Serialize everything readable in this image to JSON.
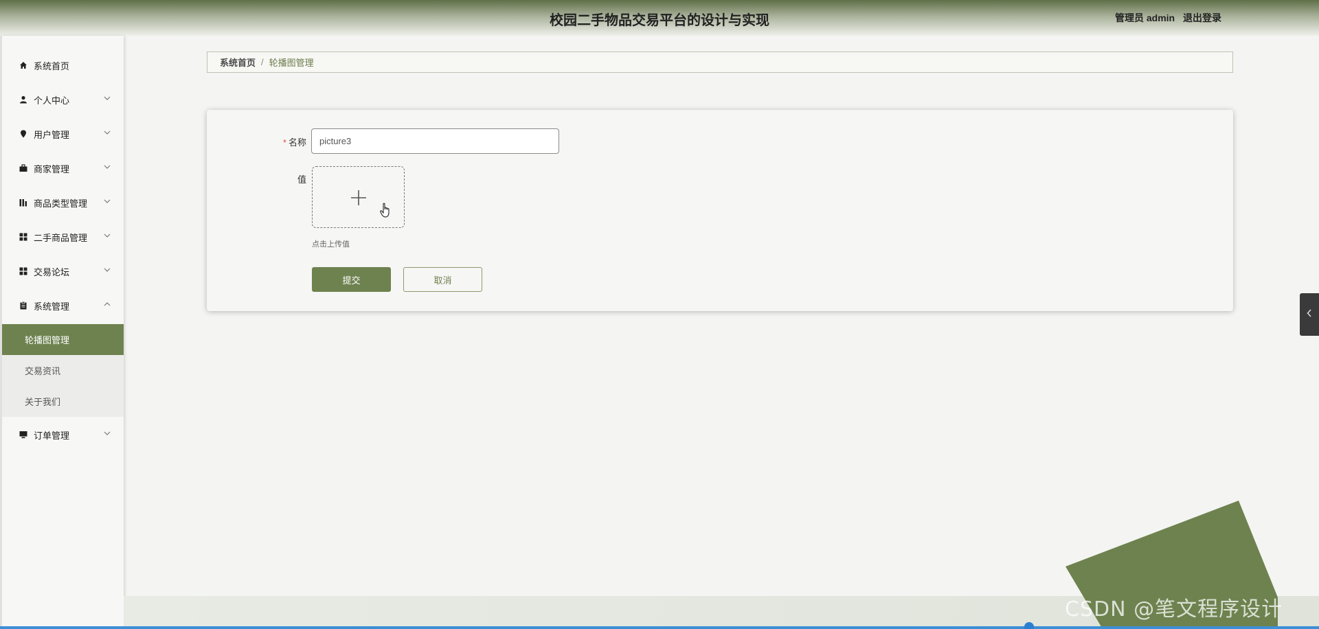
{
  "header": {
    "title": "校园二手物品交易平台的设计与实现",
    "user_label": "管理员 admin",
    "logout_label": "退出登录"
  },
  "sidebar": {
    "items": [
      {
        "label": "系统首页",
        "icon": "home-icon"
      },
      {
        "label": "个人中心",
        "icon": "person-icon"
      },
      {
        "label": "用户管理",
        "icon": "location-pin-icon"
      },
      {
        "label": "商家管理",
        "icon": "briefcase-icon"
      },
      {
        "label": "商品类型管理",
        "icon": "bar-chart-icon"
      },
      {
        "label": "二手商品管理",
        "icon": "grid-icon"
      },
      {
        "label": "交易论坛",
        "icon": "grid-icon"
      },
      {
        "label": "系统管理",
        "icon": "clipboard-icon"
      },
      {
        "label": "订单管理",
        "icon": "monitor-icon"
      }
    ],
    "system_submenu": [
      {
        "label": "轮播图管理",
        "active": true
      },
      {
        "label": "交易资讯",
        "active": false
      },
      {
        "label": "关于我们",
        "active": false
      }
    ]
  },
  "breadcrumb": {
    "home": "系统首页",
    "separator": "/",
    "current": "轮播图管理"
  },
  "form": {
    "name_label": "名称",
    "required_mark": "*",
    "name_value": "picture3",
    "value_label": "值",
    "upload_hint": "点击上传值",
    "submit_label": "提交",
    "cancel_label": "取消"
  },
  "watermark": "CSDN @笔文程序设计",
  "colors": {
    "accent": "#6e824f",
    "header_dark": "#5f7048",
    "required": "#d9534f"
  }
}
